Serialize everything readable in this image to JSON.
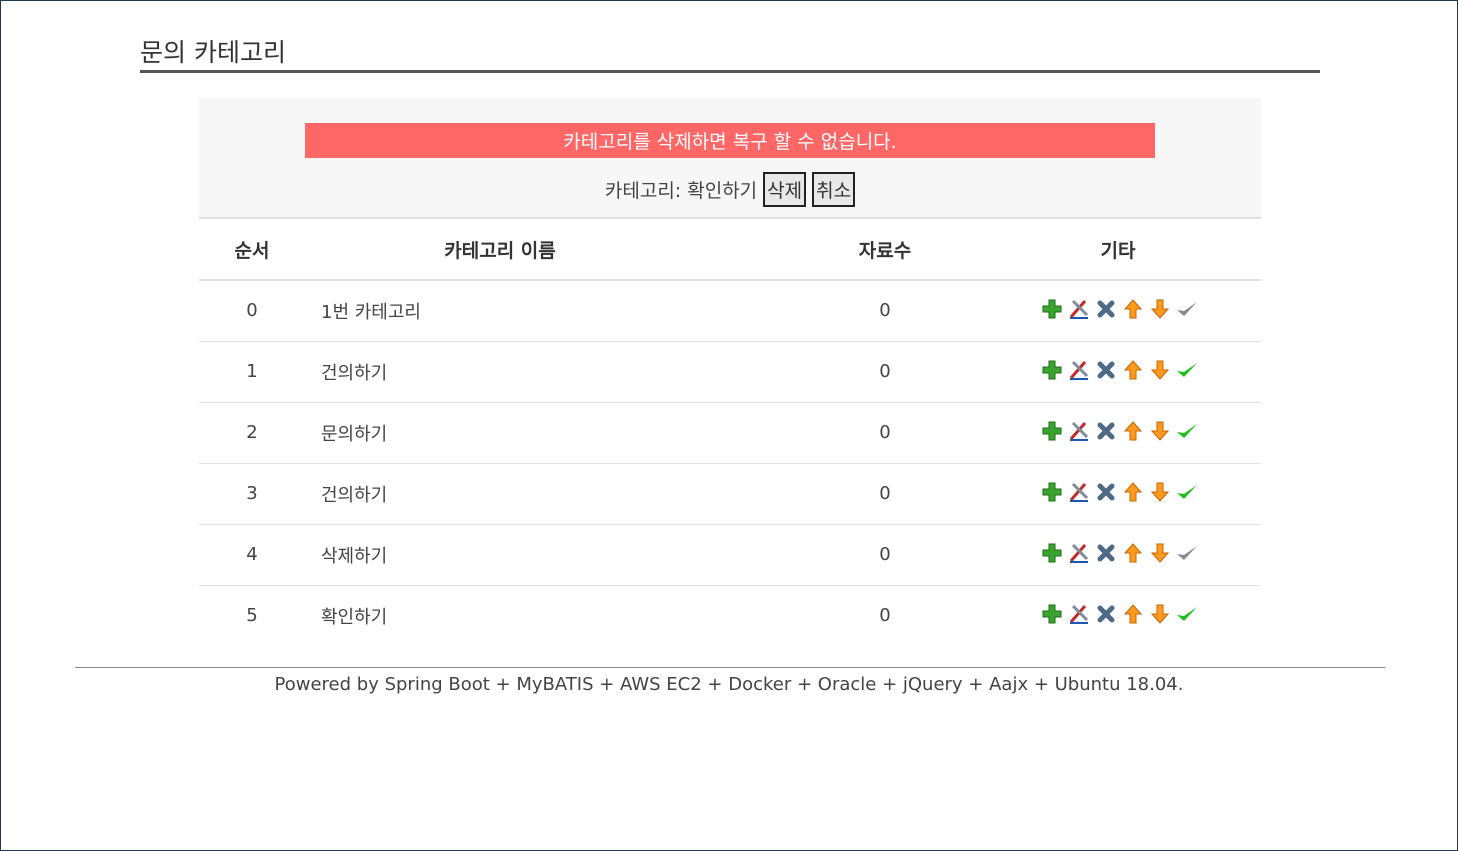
{
  "page": {
    "title": "문의 카테고리"
  },
  "alert": {
    "message": "카테고리를 삭제하면 복구 할 수 없습니다.",
    "confirm_text": "카테고리: 확인하기",
    "delete_label": "삭제",
    "cancel_label": "취소",
    "color": "#ff6666"
  },
  "table": {
    "headers": [
      "순서",
      "카테고리 이름",
      "자료수",
      "기타"
    ],
    "rows": [
      {
        "order": "0",
        "name": "1번 카테고리",
        "count": "0",
        "active": false
      },
      {
        "order": "1",
        "name": "건의하기",
        "count": "0",
        "active": true
      },
      {
        "order": "2",
        "name": "문의하기",
        "count": "0",
        "active": true
      },
      {
        "order": "3",
        "name": "건의하기",
        "count": "0",
        "active": true
      },
      {
        "order": "4",
        "name": "삭제하기",
        "count": "0",
        "active": false
      },
      {
        "order": "5",
        "name": "확인하기",
        "count": "0",
        "active": true
      }
    ],
    "row_icons": [
      "add-icon",
      "edit-icon",
      "delete-icon",
      "move-up-icon",
      "move-down-icon",
      "check-icon"
    ]
  },
  "footer": {
    "text": "Powered by Spring Boot + MyBATIS + AWS EC2 + Docker + Oracle + jQuery + Aajx + Ubuntu 18.04."
  }
}
